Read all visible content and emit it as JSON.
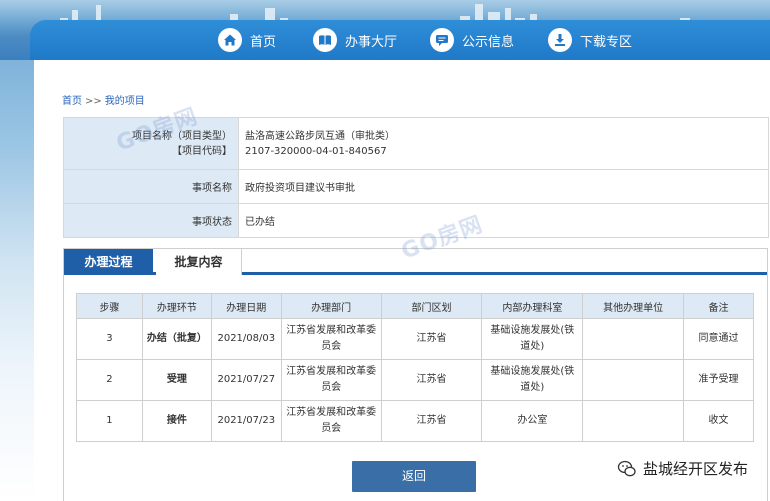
{
  "nav": {
    "items": [
      {
        "label": "首页",
        "icon": "home-icon"
      },
      {
        "label": "办事大厅",
        "icon": "book-icon"
      },
      {
        "label": "公示信息",
        "icon": "chat-icon"
      },
      {
        "label": "下载专区",
        "icon": "download-icon"
      }
    ]
  },
  "breadcrumb": {
    "home": "首页",
    "sep": ">>",
    "current": "我的项目"
  },
  "info": {
    "name_label_1": "项目名称（项目类型）",
    "name_label_2": "【项目代码】",
    "name_value_1": "盐洛高速公路步凤互通（审批类）",
    "name_value_2": "2107-320000-04-01-840567",
    "item_label": "事项名称",
    "item_value": "政府投资项目建议书审批",
    "status_label": "事项状态",
    "status_value": "已办结"
  },
  "tabs": {
    "process": "办理过程",
    "reply": "批复内容"
  },
  "process_table": {
    "headers": [
      "步骤",
      "办理环节",
      "办理日期",
      "办理部门",
      "部门区划",
      "内部办理科室",
      "其他办理单位",
      "备注"
    ],
    "rows": [
      {
        "step": "3",
        "stage": "办结（批复）",
        "date": "2021/08/03",
        "dept": "江苏省发展和改革委员会",
        "region": "江苏省",
        "office": "基础设施发展处(铁道处)",
        "other": "",
        "note": "同意通过"
      },
      {
        "step": "2",
        "stage": "受理",
        "date": "2021/07/27",
        "dept": "江苏省发展和改革委员会",
        "region": "江苏省",
        "office": "基础设施发展处(铁道处)",
        "other": "",
        "note": "准予受理"
      },
      {
        "step": "1",
        "stage": "接件",
        "date": "2021/07/23",
        "dept": "江苏省发展和改革委员会",
        "region": "江苏省",
        "office": "办公室",
        "other": "",
        "note": "收文"
      }
    ]
  },
  "back_button": "返回",
  "watermark": "GO房网",
  "footer_mark": "盐城经开区发布",
  "colors": {
    "nav_bg": "#1f79c8",
    "tab_active": "#1f5fa8",
    "label_bg": "#dde9f4",
    "button_bg": "#3a6ea6"
  }
}
